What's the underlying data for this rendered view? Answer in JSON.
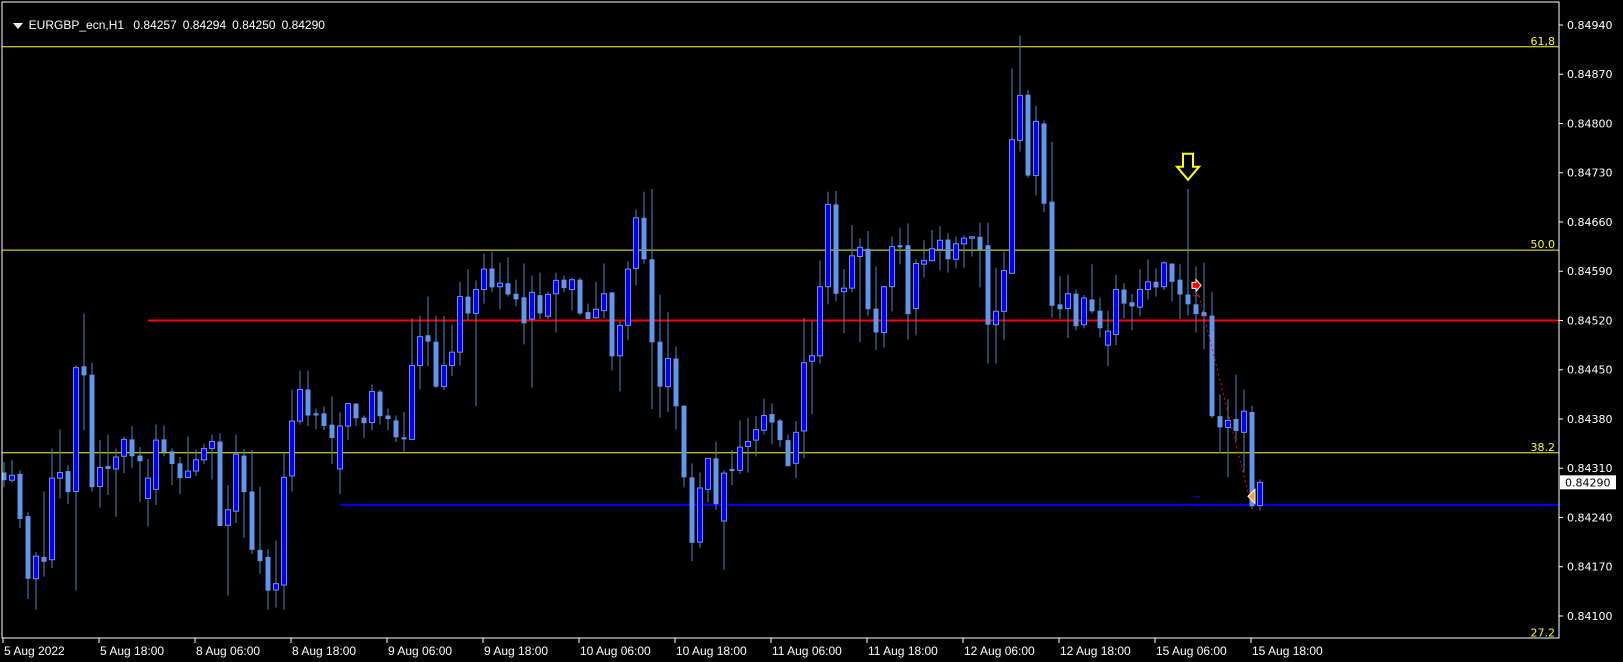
{
  "header": {
    "symbol": "EURGBP_ecn,H1",
    "open": "0.84257",
    "high": "0.84294",
    "low": "0.84250",
    "close": "0.84290"
  },
  "colors": {
    "background": "#000000",
    "bull_body": "#0000ff",
    "bear_body": "#6495ed",
    "wick": "#4f86c0",
    "fib": "#ffff00",
    "support": "#0000ff",
    "resistance": "#ff0000",
    "axis": "#ffffff"
  },
  "chart_data": {
    "type": "candlestick",
    "title": "EURGBP_ecn,H1",
    "ylim": [
      0.84085,
      0.84965
    ],
    "y_ticks": [
      "0.84940",
      "0.84870",
      "0.84800",
      "0.84730",
      "0.84660",
      "0.84590",
      "0.84520",
      "0.84450",
      "0.84380",
      "0.84310",
      "0.84240",
      "0.84170",
      "0.84100"
    ],
    "current_price": "0.84290",
    "x_ticks": [
      {
        "label": "5 Aug 2022",
        "bar": 0
      },
      {
        "label": "5 Aug 18:00",
        "bar": 12
      },
      {
        "label": "8 Aug 06:00",
        "bar": 24
      },
      {
        "label": "8 Aug 18:00",
        "bar": 36
      },
      {
        "label": "9 Aug 06:00",
        "bar": 48
      },
      {
        "label": "9 Aug 18:00",
        "bar": 60
      },
      {
        "label": "10 Aug 06:00",
        "bar": 72
      },
      {
        "label": "10 Aug 18:00",
        "bar": 84
      },
      {
        "label": "11 Aug 06:00",
        "bar": 96
      },
      {
        "label": "11 Aug 18:00",
        "bar": 108
      },
      {
        "label": "12 Aug 06:00",
        "bar": 120
      },
      {
        "label": "12 Aug 18:00",
        "bar": 132
      },
      {
        "label": "15 Aug 06:00",
        "bar": 144
      },
      {
        "label": "15 Aug 18:00",
        "bar": 156
      }
    ],
    "fib_levels": [
      {
        "label": "61,8",
        "price": 0.84909
      },
      {
        "label": "50.0",
        "price": 0.8462
      },
      {
        "label": "38.2",
        "price": 0.84332
      },
      {
        "label": "27.2",
        "price": 0.84068
      }
    ],
    "hlines": [
      {
        "name": "resistance",
        "price": 0.8452,
        "from_bar": 18,
        "color": "#ff0000"
      },
      {
        "name": "support",
        "price": 0.84258,
        "from_bar": 42,
        "color": "#0000ff"
      }
    ],
    "markers": {
      "down_arrow": {
        "bar": 148,
        "price": 0.8472
      },
      "entry": {
        "bar": 149,
        "price": 0.8457
      },
      "exit": {
        "bar": 156,
        "price": 0.8427
      },
      "stop_dash": {
        "bar": 149,
        "price": 0.84555
      },
      "target_dash": {
        "bar": 149,
        "price": 0.8427
      }
    },
    "candles": [
      [
        0.84304,
        0.84319,
        0.84283,
        0.84293
      ],
      [
        0.84293,
        0.84322,
        0.8429,
        0.843
      ],
      [
        0.84302,
        0.84307,
        0.84225,
        0.84238
      ],
      [
        0.84242,
        0.84248,
        0.84124,
        0.84153
      ],
      [
        0.84153,
        0.84191,
        0.84109,
        0.84185
      ],
      [
        0.84184,
        0.84277,
        0.84156,
        0.84177
      ],
      [
        0.8418,
        0.84338,
        0.84168,
        0.84296
      ],
      [
        0.84296,
        0.84365,
        0.84267,
        0.84304
      ],
      [
        0.84306,
        0.84314,
        0.84259,
        0.84276
      ],
      [
        0.84277,
        0.84456,
        0.84136,
        0.84453
      ],
      [
        0.84455,
        0.8453,
        0.84364,
        0.84442
      ],
      [
        0.84443,
        0.8446,
        0.84277,
        0.84283
      ],
      [
        0.84284,
        0.8435,
        0.84254,
        0.84311
      ],
      [
        0.84313,
        0.84358,
        0.84272,
        0.84309
      ],
      [
        0.84309,
        0.84338,
        0.84241,
        0.84326
      ],
      [
        0.84327,
        0.84355,
        0.84303,
        0.84351
      ],
      [
        0.84351,
        0.8437,
        0.8431,
        0.84327
      ],
      [
        0.84328,
        0.8434,
        0.84262,
        0.8432
      ],
      [
        0.84267,
        0.84323,
        0.84227,
        0.84296
      ],
      [
        0.8428,
        0.84372,
        0.84258,
        0.8435
      ],
      [
        0.84351,
        0.84371,
        0.84327,
        0.84333
      ],
      [
        0.84334,
        0.84338,
        0.84286,
        0.84316
      ],
      [
        0.84317,
        0.84326,
        0.84273,
        0.84296
      ],
      [
        0.84297,
        0.84355,
        0.84296,
        0.84306
      ],
      [
        0.84306,
        0.84337,
        0.84299,
        0.84322
      ],
      [
        0.84322,
        0.84345,
        0.84316,
        0.84338
      ],
      [
        0.84338,
        0.84358,
        0.84294,
        0.84348
      ],
      [
        0.84348,
        0.8436,
        0.84228,
        0.84228
      ],
      [
        0.84229,
        0.84286,
        0.84129,
        0.84251
      ],
      [
        0.84249,
        0.84358,
        0.84232,
        0.8433
      ],
      [
        0.84328,
        0.84337,
        0.84211,
        0.84276
      ],
      [
        0.84277,
        0.84336,
        0.84188,
        0.84194
      ],
      [
        0.84194,
        0.84284,
        0.8416,
        0.84178
      ],
      [
        0.84184,
        0.84195,
        0.84109,
        0.84136
      ],
      [
        0.84137,
        0.84207,
        0.84112,
        0.84146
      ],
      [
        0.84144,
        0.84333,
        0.84109,
        0.84297
      ],
      [
        0.84299,
        0.84422,
        0.84277,
        0.84377
      ],
      [
        0.84377,
        0.84449,
        0.84372,
        0.84422
      ],
      [
        0.84422,
        0.84449,
        0.8437,
        0.84385
      ],
      [
        0.84388,
        0.84395,
        0.84365,
        0.84385
      ],
      [
        0.84388,
        0.84398,
        0.84364,
        0.8437
      ],
      [
        0.84372,
        0.84412,
        0.84316,
        0.84353
      ],
      [
        0.84309,
        0.8439,
        0.84273,
        0.8437
      ],
      [
        0.8437,
        0.84402,
        0.8435,
        0.84402
      ],
      [
        0.84402,
        0.84402,
        0.8437,
        0.84381
      ],
      [
        0.84382,
        0.84385,
        0.84353,
        0.84374
      ],
      [
        0.84375,
        0.84429,
        0.84364,
        0.84419
      ],
      [
        0.84419,
        0.84422,
        0.84372,
        0.84384
      ],
      [
        0.84385,
        0.84395,
        0.84364,
        0.8438
      ],
      [
        0.84378,
        0.84385,
        0.84347,
        0.84354
      ],
      [
        0.84354,
        0.8439,
        0.84334,
        0.84351
      ],
      [
        0.84351,
        0.84523,
        0.84351,
        0.84456
      ],
      [
        0.84456,
        0.84527,
        0.84422,
        0.84497
      ],
      [
        0.84499,
        0.84554,
        0.84455,
        0.8449
      ],
      [
        0.8449,
        0.84527,
        0.84424,
        0.84426
      ],
      [
        0.84426,
        0.84526,
        0.84421,
        0.84456
      ],
      [
        0.84456,
        0.84514,
        0.84441,
        0.84475
      ],
      [
        0.84475,
        0.84575,
        0.84456,
        0.84554
      ],
      [
        0.84554,
        0.84593,
        0.8452,
        0.8453
      ],
      [
        0.8453,
        0.84577,
        0.84398,
        0.84564
      ],
      [
        0.84564,
        0.84615,
        0.84544,
        0.84593
      ],
      [
        0.84594,
        0.84618,
        0.8456,
        0.84567
      ],
      [
        0.84568,
        0.84602,
        0.84536,
        0.84573
      ],
      [
        0.84573,
        0.8461,
        0.84554,
        0.84557
      ],
      [
        0.84558,
        0.84578,
        0.8454,
        0.8455
      ],
      [
        0.84553,
        0.84601,
        0.84486,
        0.84516
      ],
      [
        0.84522,
        0.84584,
        0.84425,
        0.8456
      ],
      [
        0.84556,
        0.84588,
        0.84522,
        0.8453
      ],
      [
        0.84526,
        0.84561,
        0.84522,
        0.84557
      ],
      [
        0.84558,
        0.84588,
        0.84503,
        0.84577
      ],
      [
        0.84578,
        0.84584,
        0.8456,
        0.84566
      ],
      [
        0.84564,
        0.8458,
        0.84534,
        0.84578
      ],
      [
        0.84578,
        0.84581,
        0.84527,
        0.8453
      ],
      [
        0.84532,
        0.84544,
        0.84522,
        0.84522
      ],
      [
        0.84524,
        0.84575,
        0.84522,
        0.84536
      ],
      [
        0.84534,
        0.84601,
        0.84523,
        0.84558
      ],
      [
        0.8456,
        0.8456,
        0.84449,
        0.84469
      ],
      [
        0.8447,
        0.84519,
        0.84419,
        0.84513
      ],
      [
        0.84513,
        0.84604,
        0.84492,
        0.84593
      ],
      [
        0.84594,
        0.84678,
        0.8457,
        0.84666
      ],
      [
        0.84666,
        0.84703,
        0.84601,
        0.84607
      ],
      [
        0.84607,
        0.84707,
        0.84394,
        0.84489
      ],
      [
        0.8449,
        0.84557,
        0.84382,
        0.84426
      ],
      [
        0.84426,
        0.84532,
        0.8439,
        0.84466
      ],
      [
        0.84466,
        0.84483,
        0.84365,
        0.84398
      ],
      [
        0.84399,
        0.84399,
        0.84283,
        0.84297
      ],
      [
        0.84297,
        0.84317,
        0.84178,
        0.84204
      ],
      [
        0.84205,
        0.84304,
        0.84197,
        0.84282
      ],
      [
        0.8428,
        0.84324,
        0.84262,
        0.84324
      ],
      [
        0.84324,
        0.84348,
        0.84251,
        0.84259
      ],
      [
        0.84235,
        0.84307,
        0.84166,
        0.84303
      ],
      [
        0.84309,
        0.84336,
        0.84286,
        0.84306
      ],
      [
        0.84307,
        0.84378,
        0.84302,
        0.8434
      ],
      [
        0.84341,
        0.84382,
        0.84304,
        0.84348
      ],
      [
        0.8435,
        0.84384,
        0.84327,
        0.84365
      ],
      [
        0.84364,
        0.84409,
        0.84358,
        0.84385
      ],
      [
        0.84387,
        0.84402,
        0.84344,
        0.84375
      ],
      [
        0.84378,
        0.8438,
        0.8434,
        0.8435
      ],
      [
        0.8435,
        0.84358,
        0.84313,
        0.84313
      ],
      [
        0.84317,
        0.84377,
        0.84296,
        0.84361
      ],
      [
        0.84363,
        0.84524,
        0.84324,
        0.8446
      ],
      [
        0.84462,
        0.84519,
        0.84387,
        0.8447
      ],
      [
        0.8447,
        0.84605,
        0.84459,
        0.84568
      ],
      [
        0.84568,
        0.84703,
        0.84543,
        0.84685
      ],
      [
        0.84685,
        0.84704,
        0.84547,
        0.84558
      ],
      [
        0.84561,
        0.84593,
        0.84502,
        0.84566
      ],
      [
        0.84566,
        0.84656,
        0.8456,
        0.84612
      ],
      [
        0.84611,
        0.84637,
        0.84489,
        0.84624
      ],
      [
        0.84622,
        0.84647,
        0.84526,
        0.84536
      ],
      [
        0.84537,
        0.84597,
        0.84478,
        0.84503
      ],
      [
        0.84503,
        0.8457,
        0.84482,
        0.84568
      ],
      [
        0.84568,
        0.84639,
        0.84533,
        0.84625
      ],
      [
        0.84627,
        0.84652,
        0.846,
        0.84624
      ],
      [
        0.84627,
        0.84658,
        0.84493,
        0.84529
      ],
      [
        0.84537,
        0.84607,
        0.84499,
        0.84601
      ],
      [
        0.846,
        0.84634,
        0.84581,
        0.84605
      ],
      [
        0.84605,
        0.84649,
        0.84604,
        0.84622
      ],
      [
        0.84621,
        0.84654,
        0.84591,
        0.84634
      ],
      [
        0.84635,
        0.84644,
        0.84588,
        0.84607
      ],
      [
        0.84607,
        0.84639,
        0.84594,
        0.84629
      ],
      [
        0.84629,
        0.84641,
        0.84595,
        0.84637
      ],
      [
        0.84637,
        0.84639,
        0.84611,
        0.84639
      ],
      [
        0.84639,
        0.84659,
        0.84567,
        0.84621
      ],
      [
        0.84627,
        0.84659,
        0.84459,
        0.84514
      ],
      [
        0.84514,
        0.84595,
        0.84459,
        0.84533
      ],
      [
        0.84533,
        0.84618,
        0.84492,
        0.84591
      ],
      [
        0.84587,
        0.84878,
        0.84587,
        0.84777
      ],
      [
        0.84776,
        0.84925,
        0.8476,
        0.8484
      ],
      [
        0.84841,
        0.84848,
        0.84723,
        0.84726
      ],
      [
        0.84726,
        0.84825,
        0.84698,
        0.84803
      ],
      [
        0.848,
        0.84804,
        0.84674,
        0.84686
      ],
      [
        0.84689,
        0.84774,
        0.84524,
        0.84541
      ],
      [
        0.84543,
        0.84583,
        0.84522,
        0.84536
      ],
      [
        0.84537,
        0.84585,
        0.84495,
        0.84558
      ],
      [
        0.84558,
        0.84564,
        0.84506,
        0.84512
      ],
      [
        0.84514,
        0.84556,
        0.84509,
        0.84552
      ],
      [
        0.8455,
        0.846,
        0.8453,
        0.84533
      ],
      [
        0.84534,
        0.84553,
        0.84496,
        0.84509
      ],
      [
        0.84485,
        0.84534,
        0.84455,
        0.84505
      ],
      [
        0.845,
        0.84585,
        0.84485,
        0.84564
      ],
      [
        0.84564,
        0.84573,
        0.84523,
        0.84544
      ],
      [
        0.84546,
        0.84558,
        0.84506,
        0.8454
      ],
      [
        0.84539,
        0.84593,
        0.84526,
        0.84564
      ],
      [
        0.84564,
        0.84607,
        0.8455,
        0.84575
      ],
      [
        0.84575,
        0.84594,
        0.84554,
        0.84567
      ],
      [
        0.84568,
        0.84605,
        0.84563,
        0.84602
      ],
      [
        0.84601,
        0.84601,
        0.84547,
        0.84575
      ],
      [
        0.84578,
        0.846,
        0.84522,
        0.84557
      ],
      [
        0.84557,
        0.84707,
        0.84527,
        0.84543
      ],
      [
        0.84543,
        0.84597,
        0.84503,
        0.84529
      ],
      [
        0.84532,
        0.84602,
        0.84479,
        0.84526
      ],
      [
        0.84527,
        0.84561,
        0.84381,
        0.84384
      ],
      [
        0.84384,
        0.84415,
        0.84331,
        0.84368
      ],
      [
        0.84368,
        0.84408,
        0.84297,
        0.84378
      ],
      [
        0.8438,
        0.84443,
        0.84348,
        0.84363
      ],
      [
        0.84361,
        0.84422,
        0.84304,
        0.84391
      ],
      [
        0.8439,
        0.84399,
        0.84252,
        0.84256
      ],
      [
        0.84257,
        0.84294,
        0.8425,
        0.8429
      ]
    ]
  }
}
